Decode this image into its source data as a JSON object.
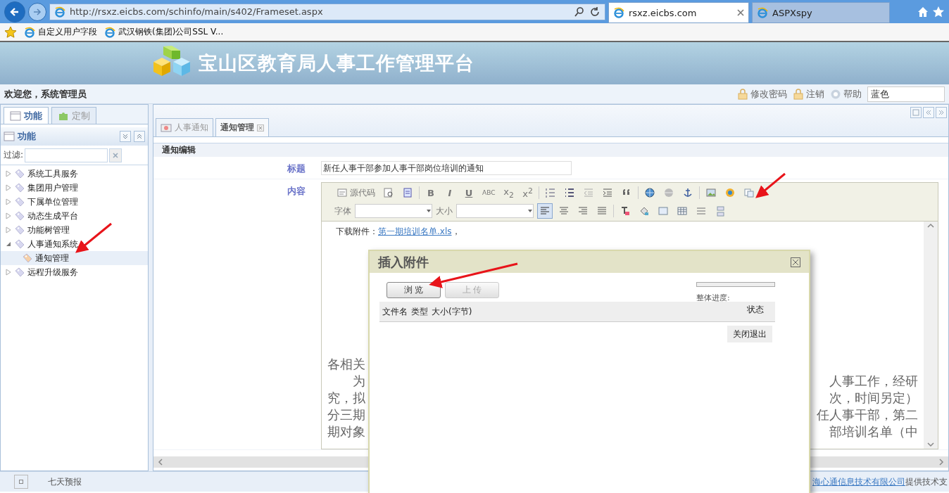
{
  "browser": {
    "address": "http://rsxz.eicbs.com/schinfo/main/s402/Frameset.aspx",
    "tabs": [
      {
        "label": "rsxz.eicbs.com",
        "selected": true
      },
      {
        "label": "ASPXspy",
        "selected": false
      }
    ],
    "favorites": [
      "自定义用户字段",
      "武汉钢铁(集团)公司SSL V..."
    ]
  },
  "header": {
    "title": "宝山区教育局人事工作管理平台"
  },
  "userbar": {
    "welcome": "欢迎您，系统管理员",
    "links": [
      "修改密码",
      "注销",
      "帮助"
    ],
    "theme": "蓝色"
  },
  "sidebar": {
    "tabs": [
      {
        "label": "功能",
        "selected": true
      },
      {
        "label": "定制",
        "selected": false
      }
    ],
    "panel_title": "功能",
    "filter_label": "过滤:",
    "tree": [
      {
        "label": "系统工具服务",
        "expanded": false,
        "selected": false
      },
      {
        "label": "集团用户管理",
        "expanded": false,
        "selected": false
      },
      {
        "label": "下属单位管理",
        "expanded": false,
        "selected": false
      },
      {
        "label": "动态生成平台",
        "expanded": false,
        "selected": false
      },
      {
        "label": "功能树管理",
        "expanded": false,
        "selected": false
      },
      {
        "label": "人事通知系统",
        "expanded": true,
        "selected": false,
        "children": [
          {
            "label": "通知管理",
            "selected": true
          }
        ]
      },
      {
        "label": "远程升级服务",
        "expanded": false,
        "selected": false
      }
    ]
  },
  "content": {
    "tabs": [
      {
        "label": "人事通知",
        "selected": false,
        "closable": false
      },
      {
        "label": "通知管理",
        "selected": true,
        "closable": true
      }
    ],
    "section_title": "通知编辑",
    "form": {
      "title_label": "标题",
      "title_value": "新任人事干部参加人事干部岗位培训的通知",
      "content_label": "内容"
    },
    "editor": {
      "source_label": "源代码",
      "format_buttons": [
        "B",
        "I",
        "U",
        "ABC",
        "x$_{2}$",
        "x$^{2}$"
      ],
      "font_label": "字体",
      "size_label": "大小",
      "attachment_prefix": "下载附件：",
      "attachment_link": "第一期培训名单.xls",
      "attachment_suffix": "，",
      "body_lines": [
        {
          "left": "各相关",
          "indent": false
        },
        {
          "left": "为",
          "right": "人事工作，经研",
          "indent": true
        },
        {
          "left": "究，拟",
          "right": "次，时间另定）",
          "indent": false
        },
        {
          "left": "分三期",
          "right": "任人事干部，第二",
          "indent": false
        },
        {
          "left": "期对象",
          "right": "部培训名单（中",
          "indent": false
        }
      ]
    }
  },
  "dialog": {
    "title": "插入附件",
    "buttons": [
      {
        "label": "浏 览",
        "disabled": false
      },
      {
        "label": "上 传",
        "disabled": true
      }
    ],
    "progress_label": "整体进度:",
    "columns": [
      "文件名",
      "类型",
      "大小(字节)",
      "状态"
    ],
    "close_label": "关闭退出"
  },
  "status_bar": {
    "label": "七天预报",
    "company_link": "海心通信息技术有限公司",
    "suffix": "提供技术支"
  }
}
